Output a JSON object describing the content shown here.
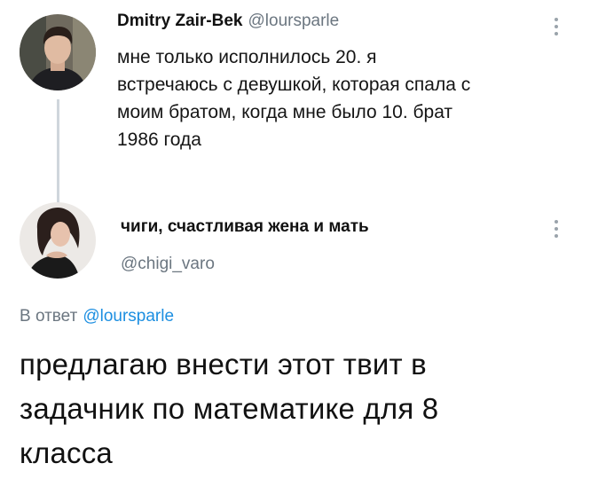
{
  "tweet1": {
    "author_name": "Dmitry Zair-Bek",
    "author_handle": "@loursparle",
    "text_lines": [
      "мне только исполнилось 20. я",
      "встречаюсь с девушкой, которая спала с",
      "моим братом, когда мне было 10. брат",
      "1986 года"
    ],
    "more_icon": "more-vertical-icon"
  },
  "tweet2": {
    "author_name": "чиги, счастливая жена и мать",
    "author_handle": "@chigi_varo",
    "reply_prefix": "В ответ",
    "reply_mention": "@loursparle",
    "text_lines": [
      "предлагаю внести этот твит в",
      "задачник по математике для 8",
      "класса"
    ],
    "more_icon": "more-vertical-icon"
  },
  "colors": {
    "handle": "#6b7680",
    "mention": "#1d8fe1",
    "thread_line": "#cfd6dc"
  }
}
